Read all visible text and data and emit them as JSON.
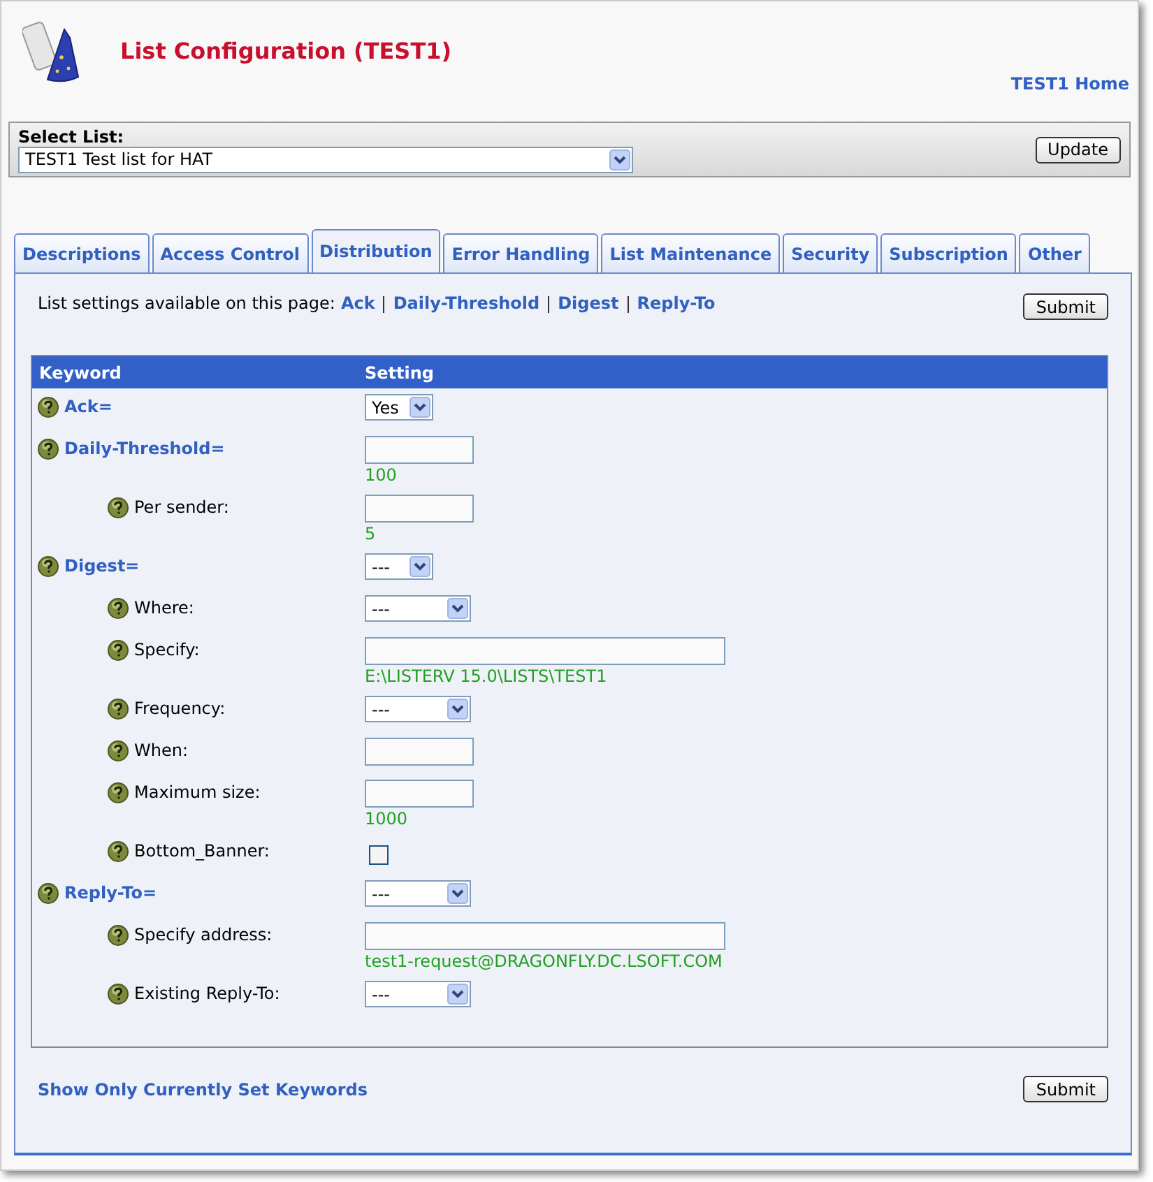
{
  "header": {
    "title": "List Configuration (TEST1)",
    "home_link": "TEST1 Home"
  },
  "select_list": {
    "label": "Select List:",
    "value": "TEST1 Test list for HAT",
    "button": "Update"
  },
  "tabs": [
    {
      "label": "Descriptions",
      "selected": false
    },
    {
      "label": "Access Control",
      "selected": false
    },
    {
      "label": "Distribution",
      "selected": true
    },
    {
      "label": "Error Handling",
      "selected": false
    },
    {
      "label": "List Maintenance",
      "selected": false
    },
    {
      "label": "Security",
      "selected": false
    },
    {
      "label": "Subscription",
      "selected": false
    },
    {
      "label": "Other",
      "selected": false
    }
  ],
  "intro": {
    "text": "List settings available on this page:",
    "links": [
      "Ack",
      "Daily-Threshold",
      "Digest",
      "Reply-To"
    ],
    "submit": "Submit"
  },
  "table": {
    "columns": [
      "Keyword",
      "Setting"
    ],
    "rows": [
      {
        "kind": "select",
        "label": "Ack=",
        "value": "Yes"
      },
      {
        "kind": "text",
        "label": "Daily-Threshold=",
        "default": "100",
        "children": [
          {
            "kind": "text",
            "label": "Per sender:",
            "default": "5"
          }
        ]
      },
      {
        "kind": "select",
        "label": "Digest=",
        "value": "---",
        "children": [
          {
            "kind": "select",
            "label": "Where:",
            "value": "---"
          },
          {
            "kind": "long-text",
            "label": "Specify:",
            "default": "E:\\LISTERV 15.0\\LISTS\\TEST1"
          },
          {
            "kind": "select",
            "label": "Frequency:",
            "value": "---"
          },
          {
            "kind": "text",
            "label": "When:"
          },
          {
            "kind": "text",
            "label": "Maximum size:",
            "default": "1000"
          },
          {
            "kind": "checkbox",
            "label": "Bottom_Banner:",
            "checked": false
          }
        ]
      },
      {
        "kind": "select",
        "label": "Reply-To=",
        "value": "---",
        "children": [
          {
            "kind": "long-text",
            "label": "Specify address:",
            "default": "test1-request@DRAGONFLY.DC.LSOFT.COM"
          },
          {
            "kind": "select",
            "label": "Existing Reply-To:",
            "value": "---"
          }
        ]
      }
    ]
  },
  "footer": {
    "link": "Show Only Currently Set Keywords",
    "submit": "Submit"
  }
}
